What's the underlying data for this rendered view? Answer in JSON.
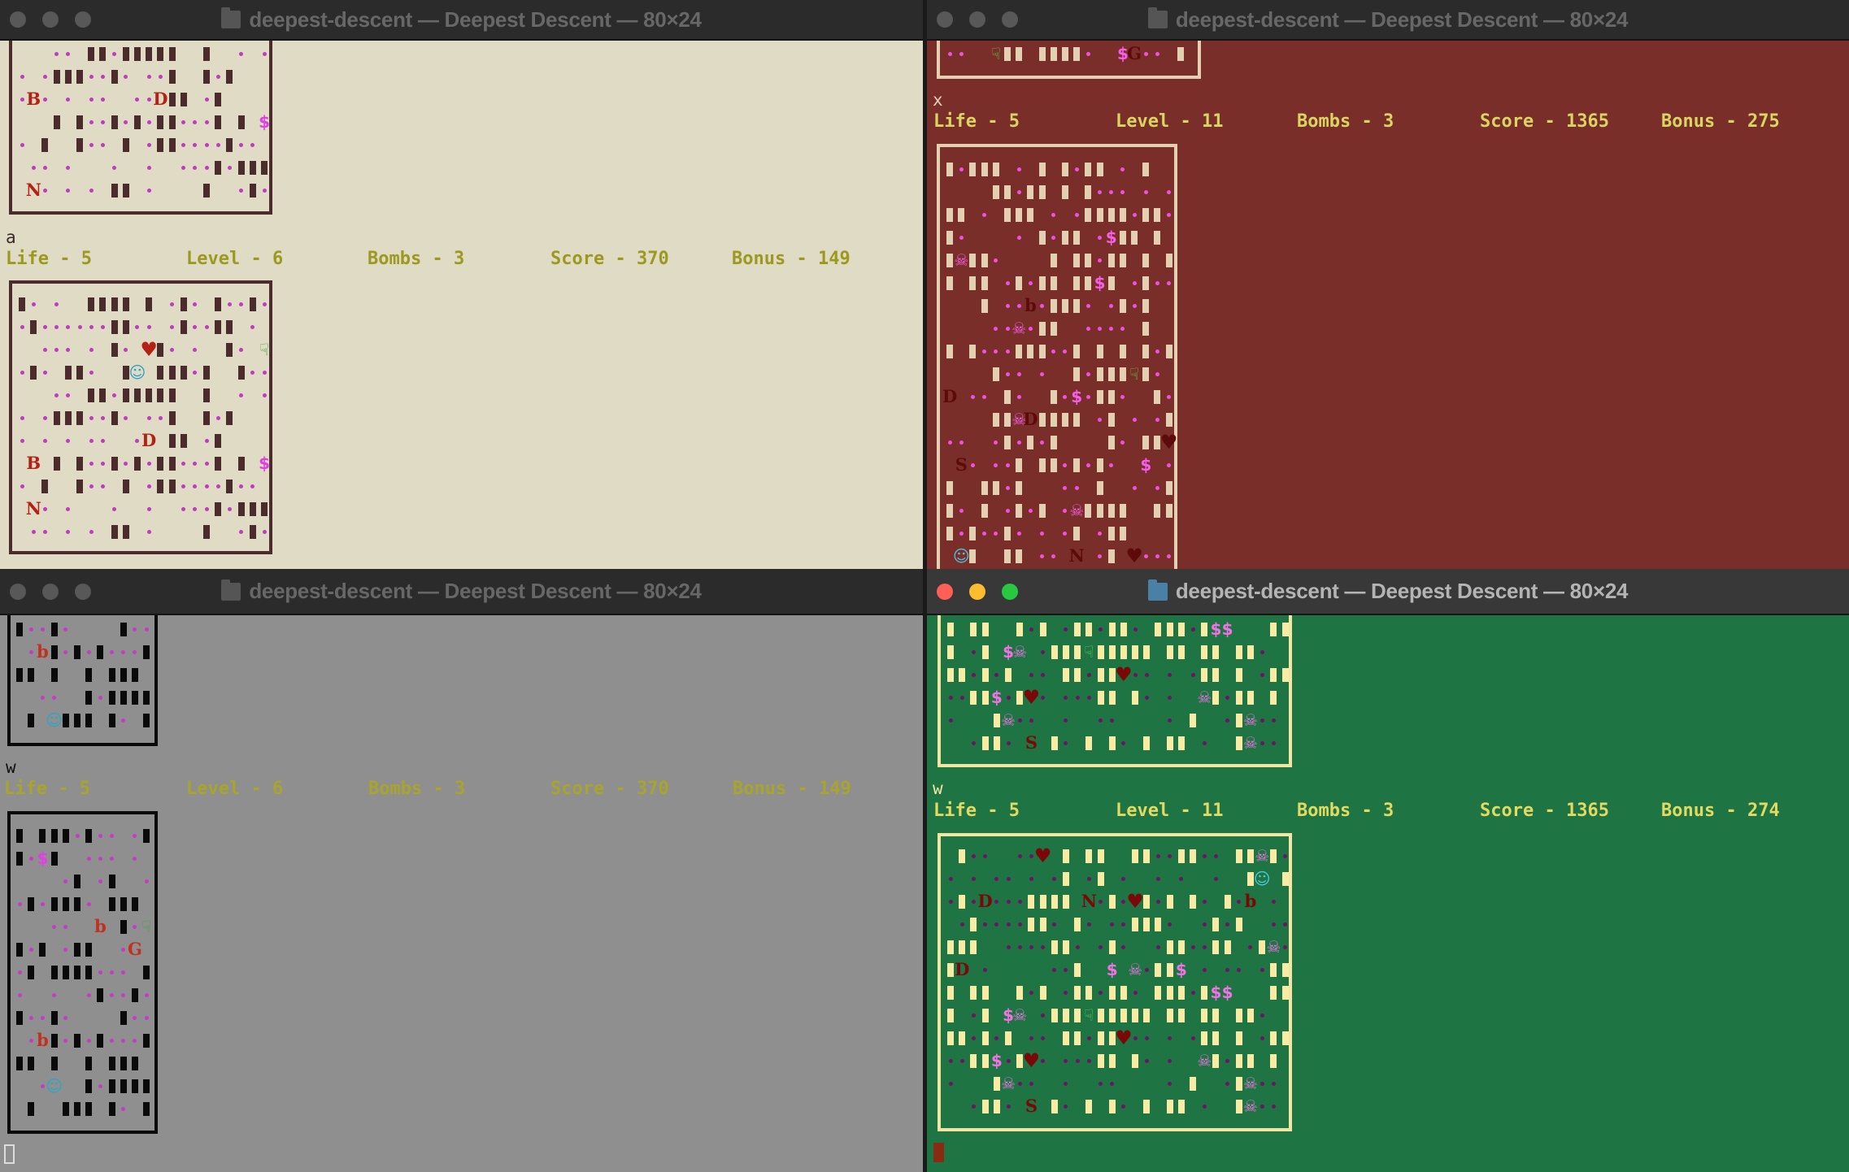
{
  "title": "deepest-descent — Deepest Descent — 80×24",
  "status_labels": {
    "life": "Life - ",
    "level": "Level - ",
    "bombs": "Bombs - ",
    "score": "Score - ",
    "bonus": "Bonus - "
  },
  "legend": {
    "#": "wall-block",
    ".": "dot",
    "$": "dollar-icon",
    "H": "heart-icon",
    "@": "smiley-icon",
    "K": "skull-icon",
    "F": "pointing-hand-icon"
  },
  "windows": [
    {
      "id": "top-left",
      "active": false,
      "key": "a",
      "status": {
        "life": "5",
        "level": "6",
        "bombs": "3",
        "score": "370",
        "bonus": "149"
      },
      "colors": {
        "bg": "#e0dbc5",
        "wall": "#4b2b2b",
        "dot": "#c23ac2",
        "letter": "#b32214",
        "dollar": "#e13fe6",
        "heart": "#b32214",
        "smiley": "#2aa0c4",
        "skull": "#e13fe6",
        "flag": "#3aa23a",
        "border": "#4b2b2b",
        "key": "#3a2a2a",
        "status": "#9b9a1e"
      },
      "map_top": [
        "   .. ##.#####  #  . .",
        ". .###..#. ..#  #.#",
        ".B. . ..  ..D## .#",
        "   # #..#.#.##...# # $",
        ". #  #.. # .##....#..",
        " .. .   .  .  ...#.###",
        " N. . . ## .    #  .#."
      ],
      "map": [
        "#. .  #### # .#. #..#.",
        ".#......##.. .#..## .",
        "  ... . #. H#. .  #. F",
        ".#. ##.  #@ ###.#  #..",
        "   .. ##.#####  #  . .",
        ". .###..#. ..#  #.#",
        ". . . ..  .D ## .#",
        " B # #..#.#.##...# # $",
        ". #  #.. # .##....#..",
        " N. .   .  .  ...#.###",
        " .. . . ## .    #  .#."
      ]
    },
    {
      "id": "top-right",
      "active": false,
      "key": "x",
      "status": {
        "life": "5",
        "level": "11",
        "bombs": "3",
        "score": "1365",
        "bonus": "275"
      },
      "colors": {
        "bg": "#7a2e2a",
        "wall": "#e3cfb2",
        "dot": "#f24fe4",
        "letter": "#5c0a0a",
        "dollar": "#f55ee8",
        "heart": "#5c0a0a",
        "smiley": "#4cc4de",
        "skull": "#f55ee8",
        "flag": "#5cc84a",
        "border": "#e3cfb2",
        "key": "#e3cfb2",
        "status": "#d9d560"
      },
      "map_top": [
        "..  F## ####.  $G.. #"
      ],
      "map": [
        "#.### . # #.## . #",
        "    ##.## # #... . .",
        "## . ### . .####.##.",
        "#.    . #.## .$## #",
        "#K##.    # ##.## # #",
        "# ## .#.## ##$# .#..",
        "   # ..b.###. .#.#",
        "    ..K.##  .... #",
        "# #...###..# # # #.#",
        "    #.. .  #.###F#.",
        "D .. #.  #.$.##.  #.",
        "    ##KD#### .# . .#",
        "..  .#.#.#    #. ##H",
        " S. ..# ##.#.#.  $ .",
        "#  ##.#   .. #  . .#",
        "#. # .#.# .K####  ##",
        "#.#..#. . .# .##",
        " @#  ## .. N .# H..."
      ]
    },
    {
      "id": "bottom-left",
      "active": false,
      "key": "w",
      "status": {
        "life": "5",
        "level": "6",
        "bombs": "3",
        "score": "370",
        "bonus": "149"
      },
      "colors": {
        "bg": "#8f8f8f",
        "wall": "#0a0a0a",
        "dot": "#c43cc4",
        "letter": "#c2301e",
        "dollar": "#e23ee8",
        "heart": "#c2301e",
        "smiley": "#2aa6c8",
        "skull": "#e23ee8",
        "flag": "#3aa83a",
        "border": "#0a0a0a",
        "key": "#111111",
        "status": "#a9a42c"
      },
      "map_top": [
        "#..#.    #..",
        " .b#.#.#...#",
        "## #  # ###",
        "  ..  #.####",
        " # @### #. #"
      ],
      "map": [
        "# ###.#.. .#",
        "#.$#  ... .",
        "    .# .#  .",
        ".#.###. ###",
        "   ..  b #.F",
        "#.# .##  .G",
        ".# ####... #",
        ".  .  .#..#.",
        "#..#.    #..",
        " .b#.#.#...#",
        "## #  # ###",
        "  .@  #.####",
        " #  ### #. #"
      ]
    },
    {
      "id": "bottom-right",
      "active": true,
      "key": "w",
      "status": {
        "life": "5",
        "level": "11",
        "bombs": "3",
        "score": "1365",
        "bonus": "274"
      },
      "colors": {
        "bg": "#1e7442",
        "wall": "#f8eba4",
        "dot": "#6c1464",
        "letter": "#7a0808",
        "dollar": "#f272e6",
        "heart": "#7a0808",
        "smiley": "#4cc8e0",
        "skull": "#f272e6",
        "flag": "#62d060",
        "border": "#f3e6a2",
        "key": "#f3e6a2",
        "status": "#e2da62"
      },
      "map_top": [
        "# ##  #.# .##.##. ###.#$$   ##",
        "# .# $K .###F##### ## ## ##.",
        "##.#.# .. ##.##H.. . .## # .##",
        "..##$.#H. ...## #. .  K#.## #",
        ".   #K..  .  ..    . #  .#K..",
        "  .##. S #. # #. # ## .  #K.."
      ],
      "map": [
        " #..  ..H # ##  ##..##.. ##K#.",
        ". . .. . .# .# .  . .  .  #@ #",
        ".#.D...#### N.#.H#.# #. #.b .",
        " .#....##. #. ..###.  .#.#  ..",
        "###  ....##. .#.  .##..## .#K.",
        "#D .     ..#  $ K.##$ . .. .##",
        "# ##  #.# .##.##. ###.#$$   ##",
        "# .# $K .###F##### ## ## ##.",
        "##.#.# .. ##.##H.. . .## # .##",
        "..##$.#H. ...## #. .  K#.## #",
        ".   #K..  .  ..    . #  .#K..",
        "  .##. S #. # #. # ## .  #K.."
      ]
    }
  ]
}
